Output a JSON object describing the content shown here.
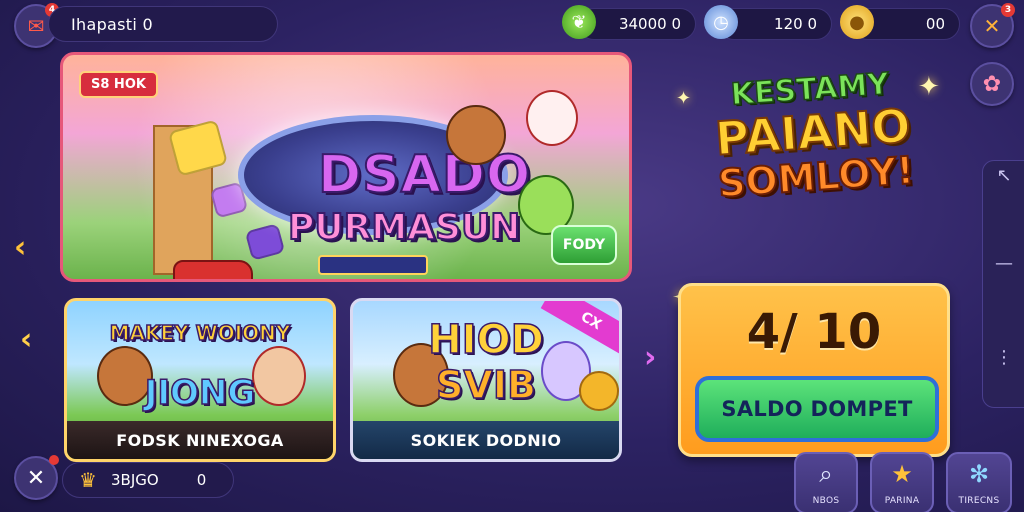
{
  "header": {
    "player_name": "Ihapasti 0",
    "profile_badge": "4",
    "currency_1_value": "34000 0",
    "currency_2_value": "120 0",
    "currency_3_value": "00",
    "close_badge": "3"
  },
  "banner": {
    "tag": "S8 HOK",
    "title_line1": "DSADO",
    "title_line2": "PURMASUN",
    "subtitle": "",
    "play_label": "FODY"
  },
  "promo": {
    "line1": "KESTAMY",
    "line2": "PAIANO",
    "line3": "SOMLOY!"
  },
  "cards": [
    {
      "title_top": "MAKEY WOIONY",
      "title_main": "JIONG",
      "footer": "FODSK NINEXOGA"
    },
    {
      "title_top": "HIOD",
      "title_main": "SVIB",
      "footer": "SOKIEK DODNIO",
      "ribbon": "CX"
    }
  ],
  "balance": {
    "amount": "4/ 10",
    "button_label": "SALDO DOMPET"
  },
  "footer": {
    "resource_value": "3BJGO",
    "resource_count": "0",
    "nav": [
      {
        "label": "NBOS"
      },
      {
        "label": "PARINA"
      },
      {
        "label": "TIRECNS"
      }
    ]
  },
  "colors": {
    "background": "#2c2262",
    "banner_border": "#e6587a",
    "balance_panel": "#ffb030",
    "primary_button": "#2fc66a"
  },
  "icons": {
    "profile": "mail-icon",
    "currency_1": "leaf-gem-icon",
    "currency_2": "clock-icon",
    "currency_3": "coin-icon",
    "close": "crossed-tools-icon",
    "top_right_2": "rose-icon",
    "rail": [
      "back-icon",
      "menu-line-icon",
      "dots-icon"
    ],
    "nav": [
      "search-icon",
      "star-icon",
      "settings-icon"
    ]
  }
}
